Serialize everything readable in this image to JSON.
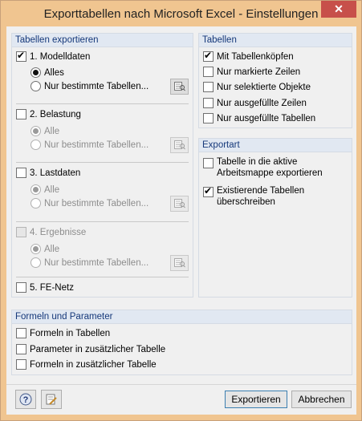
{
  "window": {
    "title": "Exporttabellen nach Microsoft Excel - Einstellungen",
    "close_glyph": "✕"
  },
  "export_tables": {
    "header": "Tabellen exportieren",
    "sections": [
      {
        "label": "1. Modelldaten",
        "checked": true,
        "enabled": true,
        "opt_all": "Alles",
        "opt_selected": "Nur bestimmte Tabellen..."
      },
      {
        "label": "2. Belastung",
        "checked": false,
        "enabled": true,
        "opt_all": "Alle",
        "opt_selected": "Nur bestimmte Tabellen..."
      },
      {
        "label": "3. Lastdaten",
        "checked": false,
        "enabled": true,
        "opt_all": "Alle",
        "opt_selected": "Nur bestimmte Tabellen..."
      },
      {
        "label": "4. Ergebnisse",
        "checked": false,
        "enabled": false,
        "opt_all": "Alle",
        "opt_selected": "Nur bestimmte Tabellen..."
      }
    ],
    "fe_mesh": "5. FE-Netz"
  },
  "tables": {
    "header": "Tabellen",
    "items": [
      {
        "label": "Mit Tabellenköpfen",
        "checked": true
      },
      {
        "label": "Nur markierte Zeilen",
        "checked": false
      },
      {
        "label": "Nur selektierte Objekte",
        "checked": false
      },
      {
        "label": "Nur ausgefüllte Zeilen",
        "checked": false
      },
      {
        "label": "Nur ausgefüllte Tabellen",
        "checked": false
      }
    ]
  },
  "export_type": {
    "header": "Exportart",
    "opt1_line1": "Tabelle in die aktive",
    "opt1_line2": "Arbeitsmappe exportieren",
    "opt2_line1": "Existierende Tabellen",
    "opt2_line2": "überschreiben"
  },
  "formulas": {
    "header": "Formeln und Parameter",
    "items": [
      {
        "label": "Formeln in Tabellen",
        "checked": false
      },
      {
        "label": "Parameter in zusätzlicher Tabelle",
        "checked": false
      },
      {
        "label": "Formeln in zusätzlicher Tabelle",
        "checked": false
      }
    ]
  },
  "footer": {
    "export_label": "Exportieren",
    "cancel_label": "Abbrechen",
    "help_icon": "help-icon",
    "edit_icon": "edit-icon"
  },
  "colors": {
    "title_bg": "#f0c590",
    "header_bg": "#e1e8f2",
    "header_text": "#15387a",
    "close_bg": "#c7504a"
  }
}
